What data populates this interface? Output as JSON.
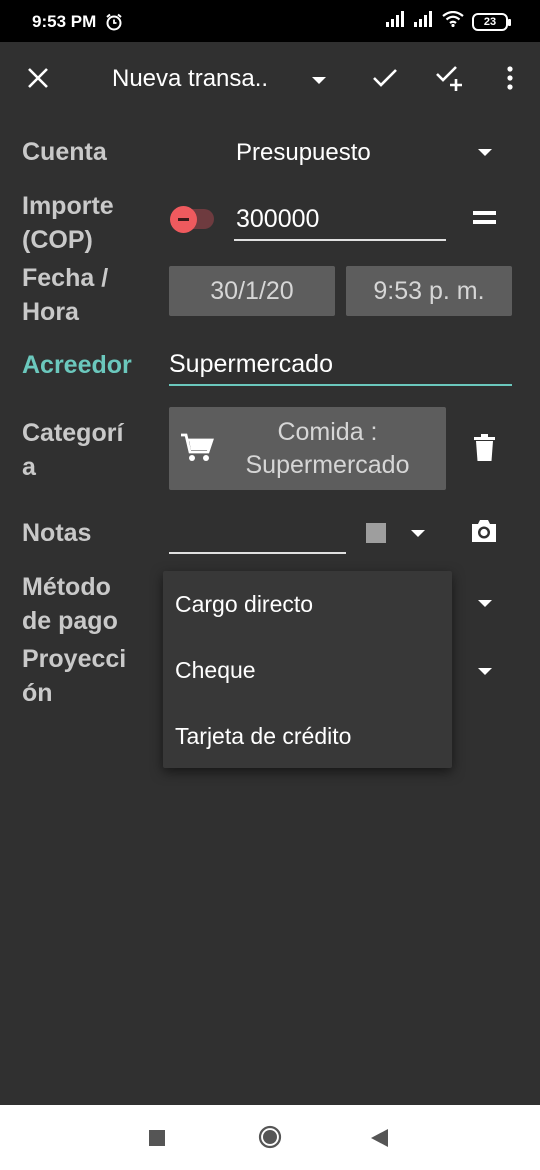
{
  "status_bar": {
    "time": "9:53 PM",
    "battery": "23",
    "icons": [
      "alarm-icon",
      "signal-icon",
      "signal-icon",
      "wifi-icon",
      "battery-icon"
    ]
  },
  "app_bar": {
    "title": "Nueva transa..",
    "icons": [
      "close-icon",
      "dropdown-icon",
      "check-icon",
      "check-plus-icon",
      "more-vert-icon"
    ]
  },
  "form": {
    "account": {
      "label": "Cuenta",
      "value": "Presupuesto"
    },
    "amount": {
      "label_line1": "Importe",
      "label_line2": "(COP)",
      "value": "300000"
    },
    "datetime": {
      "label_line1": "Fecha /",
      "label_line2": "Hora",
      "date": "30/1/20",
      "time": "9:53 p. m."
    },
    "payee": {
      "label": "Acreedor",
      "value": "Supermercado"
    },
    "category": {
      "label_line1": "Categorí",
      "label_line2": "a",
      "value_line1": "Comida :",
      "value_line2": "Supermercado"
    },
    "notes": {
      "label": "Notas",
      "value": ""
    },
    "payment_method": {
      "label_line1": "Método",
      "label_line2": "de pago"
    },
    "projection": {
      "label_line1": "Proyecci",
      "label_line2": "ón"
    }
  },
  "payment_menu": {
    "options": [
      "Cargo directo",
      "Cheque",
      "Tarjeta de crédito"
    ]
  },
  "colors": {
    "background": "#303030",
    "accent": "#6bc8bd",
    "negative_toggle": "#ef5a5e",
    "field_box": "#5d5d5d"
  },
  "nav_bar": {
    "icons": [
      "recents-square-icon",
      "home-circle-icon",
      "back-triangle-icon"
    ]
  }
}
